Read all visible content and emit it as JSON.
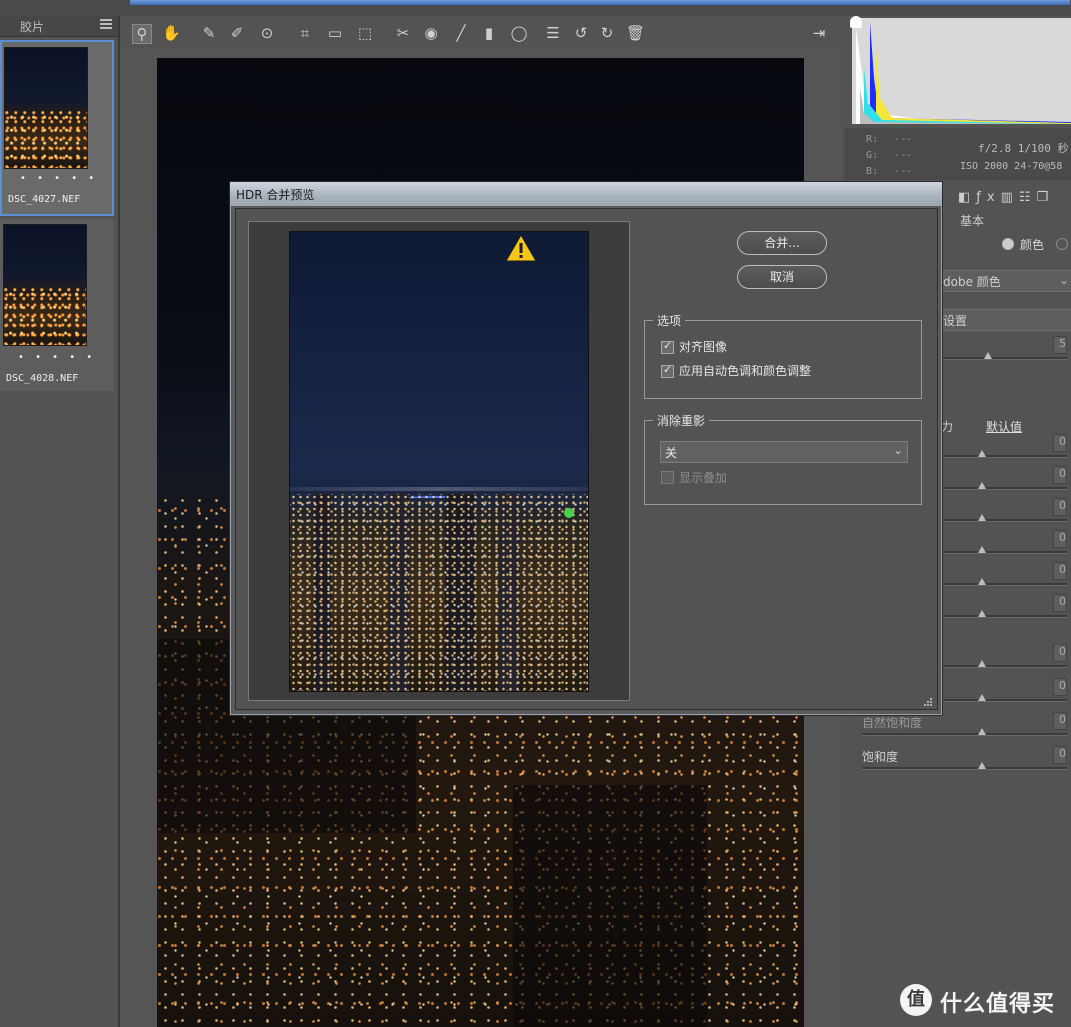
{
  "filmstrip": {
    "title": "胶片",
    "items": [
      {
        "filename": "DSC_4027.NEF",
        "dots": "• • • • •",
        "selected": true
      },
      {
        "filename": "DSC_4028.NEF",
        "dots": "• • • • •",
        "selected": false
      }
    ]
  },
  "toolbar": {
    "tools": [
      "zoom-icon",
      "hand-icon",
      "white-balance-icon",
      "color-sampler-icon",
      "target-adjust-icon",
      "crop-icon",
      "straighten-icon",
      "transform-icon",
      "spot-removal-icon",
      "red-eye-icon",
      "adjustment-brush-icon",
      "graduated-filter-icon",
      "radial-filter-icon",
      "preferences-icon",
      "rotate-left-icon",
      "rotate-right-icon",
      "trash-icon"
    ]
  },
  "right_panel": {
    "exif": {
      "r_label": "R:",
      "g_label": "G:",
      "b_label": "B:",
      "r_value": "---",
      "g_value": "---",
      "b_value": "---",
      "aperture_shutter": "f/2.8  1/100 秒",
      "iso_lens": "ISO 2000  24-70@58"
    },
    "section_title_partial": "基本",
    "color_radio_label": "颜色",
    "profile_partial": "dobe 颜色",
    "preset_partial": "设置",
    "auto_partial": "力",
    "default_link": "默认值",
    "vibrance_label": "自然饱和度",
    "saturation_label": "饱和度",
    "values": [
      "5",
      "0",
      "0",
      "0",
      "0",
      "0",
      "0",
      "0",
      "0",
      "0",
      "0",
      "0"
    ]
  },
  "dialog": {
    "title": "HDR 合并预览",
    "merge_button": "合并...",
    "cancel_button": "取消",
    "options_group": "选项",
    "align_images": "对齐图像",
    "align_checked": true,
    "auto_tone": "应用自动色调和颜色调整",
    "auto_tone_checked": true,
    "deghost_group": "消除重影",
    "deghost_value": "关",
    "show_overlay": "显示叠加",
    "show_overlay_checked": false
  },
  "watermark": {
    "logo": "值",
    "text": "什么值得买"
  },
  "colors": {
    "panel_bg": "#535353",
    "dialog_title_gradient_top": "#cdd6df",
    "selection_blue": "#5b8fd6",
    "warning_yellow": "#f5c518"
  }
}
